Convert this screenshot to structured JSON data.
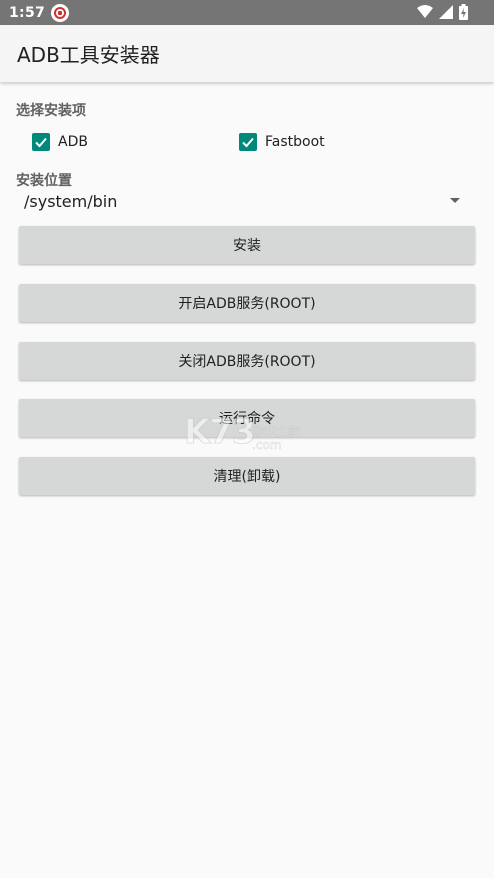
{
  "status_bar": {
    "time": "1:57"
  },
  "app_bar": {
    "title": "ADB工具安装器"
  },
  "install_items": {
    "label": "选择安装项",
    "options": [
      {
        "label": "ADB",
        "checked": true
      },
      {
        "label": "Fastboot",
        "checked": true
      }
    ]
  },
  "install_location": {
    "label": "安装位置",
    "selected": "/system/bin"
  },
  "buttons": {
    "install": "安装",
    "start_adb": "开启ADB服务(ROOT)",
    "stop_adb": "关闭ADB服务(ROOT)",
    "run_command": "运行命令",
    "cleanup": "清理(卸载)"
  },
  "watermark": {
    "brand": "K73",
    "text": "游戏之家",
    "domain": ".com"
  },
  "colors": {
    "accent": "#00897b",
    "status_bar": "#757575",
    "button": "#d6d7d7",
    "background": "#fafafa"
  },
  "icons": {
    "status_app": "shield-icon",
    "wifi": "wifi-icon",
    "signal": "signal-icon",
    "battery": "battery-charging-icon",
    "checkbox": "checkbox-checked-icon",
    "dropdown": "dropdown-arrow-icon"
  }
}
